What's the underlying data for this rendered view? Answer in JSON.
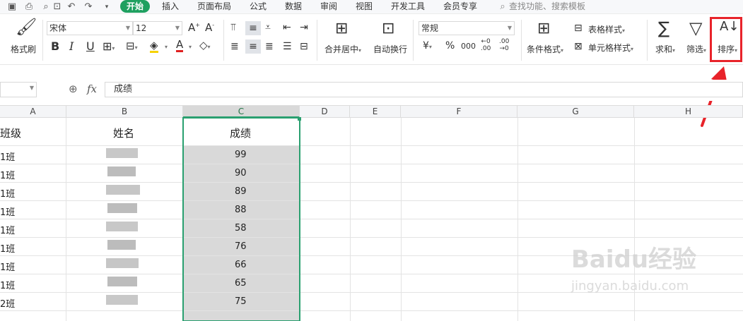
{
  "menubar": {
    "quick_icons": [
      "save-icon",
      "print-icon",
      "print-preview-icon",
      "undo-icon",
      "redo-icon",
      "more-icon"
    ],
    "tabs": [
      "开始",
      "插入",
      "页面布局",
      "公式",
      "数据",
      "审阅",
      "视图",
      "开发工具",
      "会员专享"
    ],
    "search_placeholder": "查找功能、搜索模板",
    "active_tab": "开始",
    "accent_color": "#1fa060"
  },
  "ribbon": {
    "format_painter": "格式刷",
    "font_name": "宋体",
    "font_size": "12",
    "bold": "B",
    "italic": "I",
    "underline": "U",
    "merge_center": "合并居中",
    "wrap_text": "自动换行",
    "number_format": "常规",
    "currency": "¥",
    "percent": "%",
    "thousands": "000",
    "cond_format": "条件格式",
    "table_style": "表格样式",
    "cell_style": "单元格样式",
    "sum": "求和",
    "filter": "筛选",
    "sort": "排序"
  },
  "highlight": {
    "color": "#e8232a"
  },
  "formula_bar": {
    "fx": "fx",
    "content": "成绩"
  },
  "columns": [
    "A",
    "B",
    "C",
    "D",
    "E",
    "F",
    "G",
    "H"
  ],
  "selected_column": "C",
  "table": {
    "headers": {
      "class": "班级",
      "name": "姓名",
      "score": "成绩"
    },
    "classes": [
      "1班",
      "1班",
      "1班",
      "1班",
      "1班",
      "1班",
      "1班",
      "1班",
      "2班"
    ],
    "scores": [
      "99",
      "90",
      "89",
      "88",
      "58",
      "76",
      "66",
      "65",
      "75"
    ]
  },
  "watermark": {
    "brand": "Baidu经验",
    "url": "jingyan.baidu.com"
  }
}
